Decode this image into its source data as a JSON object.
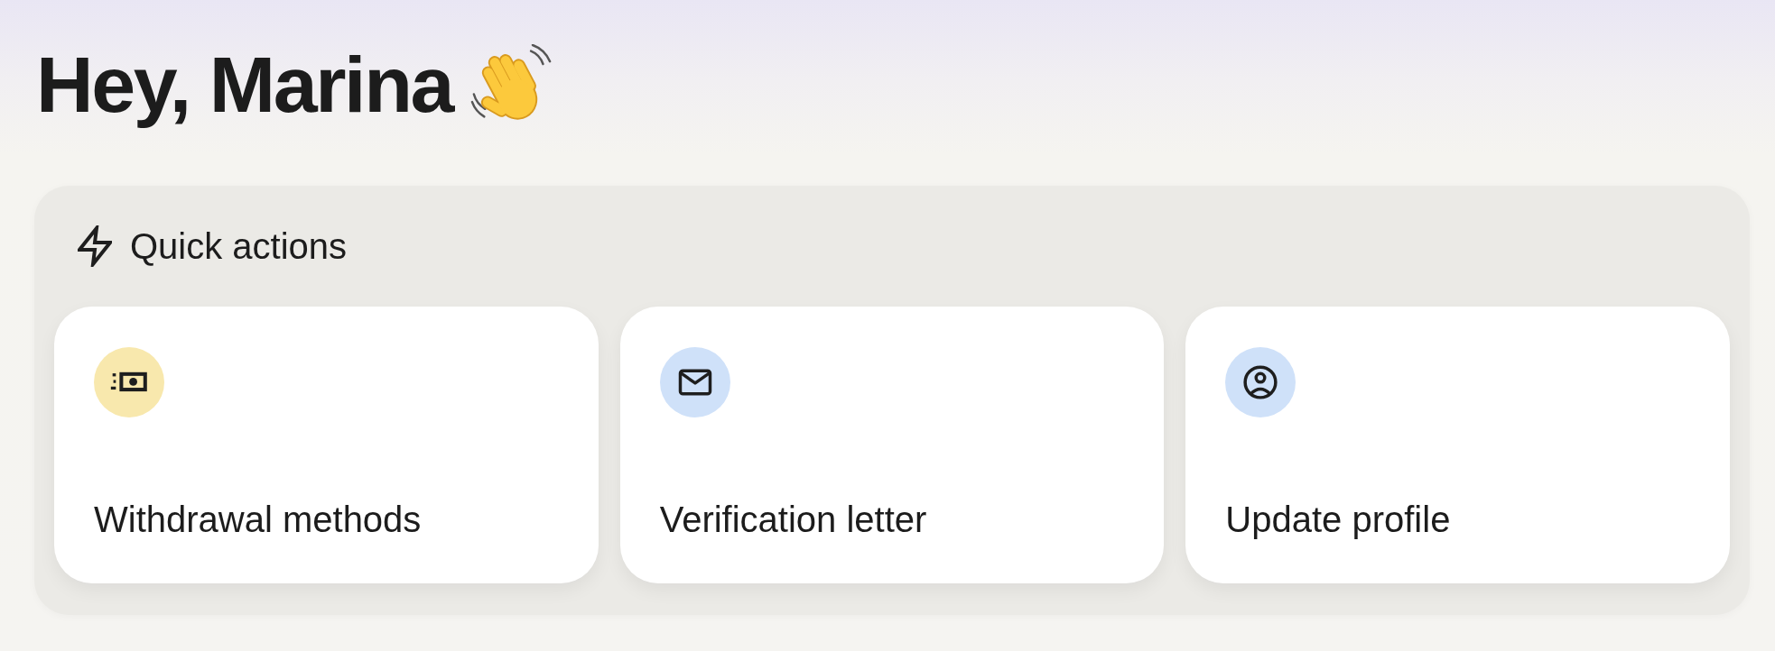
{
  "greeting": {
    "text": "Hey, Marina"
  },
  "quick_actions": {
    "title": "Quick actions",
    "actions": [
      {
        "label": "Withdrawal methods",
        "kind": "money",
        "color": "#f8e8ad"
      },
      {
        "label": "Verification letter",
        "kind": "mail",
        "color": "#cfe1f9"
      },
      {
        "label": "Update profile",
        "kind": "profile",
        "color": "#cfe1f9"
      }
    ]
  }
}
